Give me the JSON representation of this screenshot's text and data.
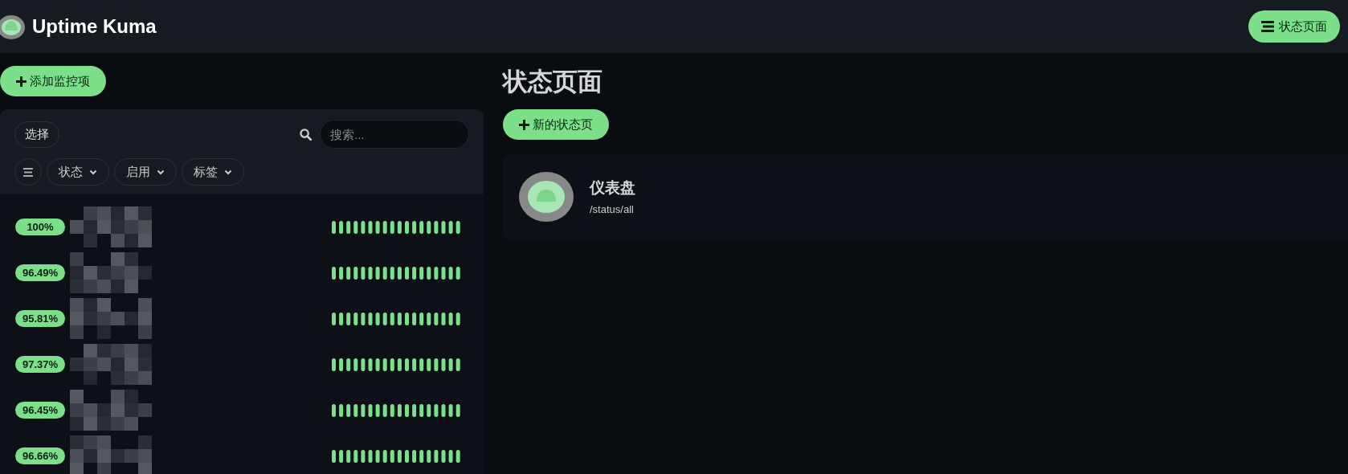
{
  "header": {
    "title": "Uptime Kuma",
    "button": "状态页面"
  },
  "add_button": "添加监控项",
  "toolbar": {
    "select": "选择",
    "search": {
      "placeholder": "搜索..."
    },
    "filters": [
      "状态",
      "启用",
      "标签"
    ]
  },
  "monitors": [
    {
      "uptime": "100%",
      "up": true
    },
    {
      "uptime": "96.49%",
      "up": true
    },
    {
      "uptime": "95.81%",
      "up": true
    },
    {
      "uptime": "97.37%",
      "up": true
    },
    {
      "uptime": "96.45%",
      "up": true
    },
    {
      "uptime": "96.66%",
      "up": true
    }
  ],
  "page": {
    "title": "状态页面",
    "new_button": "新的状态页",
    "status_pages": [
      {
        "name": "仪表盘",
        "slug": "/status/all"
      }
    ]
  }
}
